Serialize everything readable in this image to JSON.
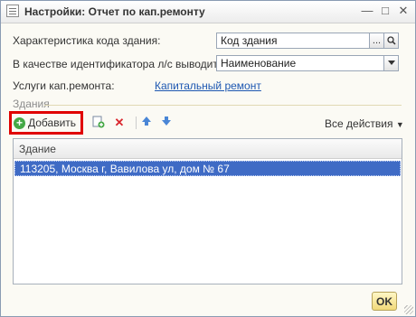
{
  "window": {
    "title": "Настройки: Отчет по кап.ремонту",
    "minimize": "—",
    "maximize": "□",
    "close": "✕"
  },
  "form": {
    "building_code_label": "Характеристика кода здания:",
    "building_code_value": "Код здания",
    "browse_button": "...",
    "search_icon": "search-icon",
    "id_label": "В качестве идентификатора л/с выводить:",
    "id_value": "Наименование",
    "services_label": "Услуги кап.ремонта:",
    "services_link": "Капитальный ремонт"
  },
  "buildings": {
    "section_title": "Здания",
    "toolbar": {
      "add_label": "Добавить",
      "all_actions": "Все действия",
      "copy_icon": "copy-add-icon",
      "delete_icon": "delete-icon",
      "up_icon": "arrow-up-icon",
      "down_icon": "arrow-down-icon"
    },
    "columns": [
      "Здание"
    ],
    "rows": [
      "113205, Москва г, Вавилова ул, дом № 67"
    ]
  },
  "footer": {
    "ok_label": "OK"
  },
  "colors": {
    "selection": "#3f6bc5",
    "link": "#1d57b1",
    "highlight_border": "#e00000",
    "ok_button": "#f1d97a"
  }
}
